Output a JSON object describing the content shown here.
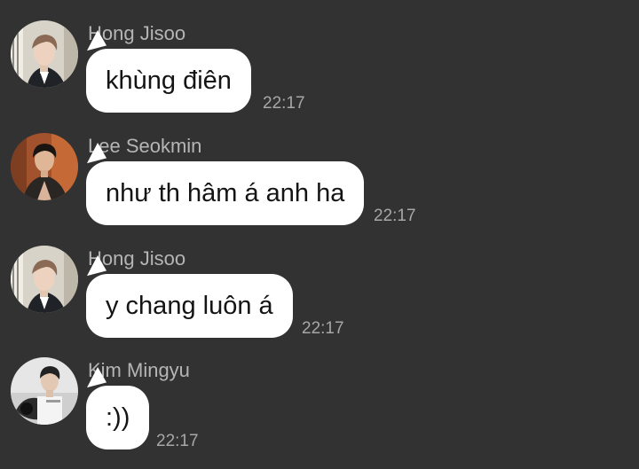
{
  "messages": [
    {
      "sender": "Hong Jisoo",
      "text": "khùng điên",
      "time": "22:17",
      "avatar": "avatar-hong-jisoo"
    },
    {
      "sender": "Lee Seokmin",
      "text": "như th hâm á anh ha",
      "time": "22:17",
      "avatar": "avatar-lee-seokmin"
    },
    {
      "sender": "Hong Jisoo",
      "text": "y chang luôn á",
      "time": "22:17",
      "avatar": "avatar-hong-jisoo"
    },
    {
      "sender": "Kim Mingyu",
      "text": ":))",
      "time": "22:17",
      "avatar": "avatar-kim-mingyu"
    }
  ],
  "colors": {
    "background": "#323232",
    "bubble": "#ffffff",
    "sender_text": "#b5b5b5",
    "time_text": "#a7a7a7",
    "message_text": "#141414"
  }
}
